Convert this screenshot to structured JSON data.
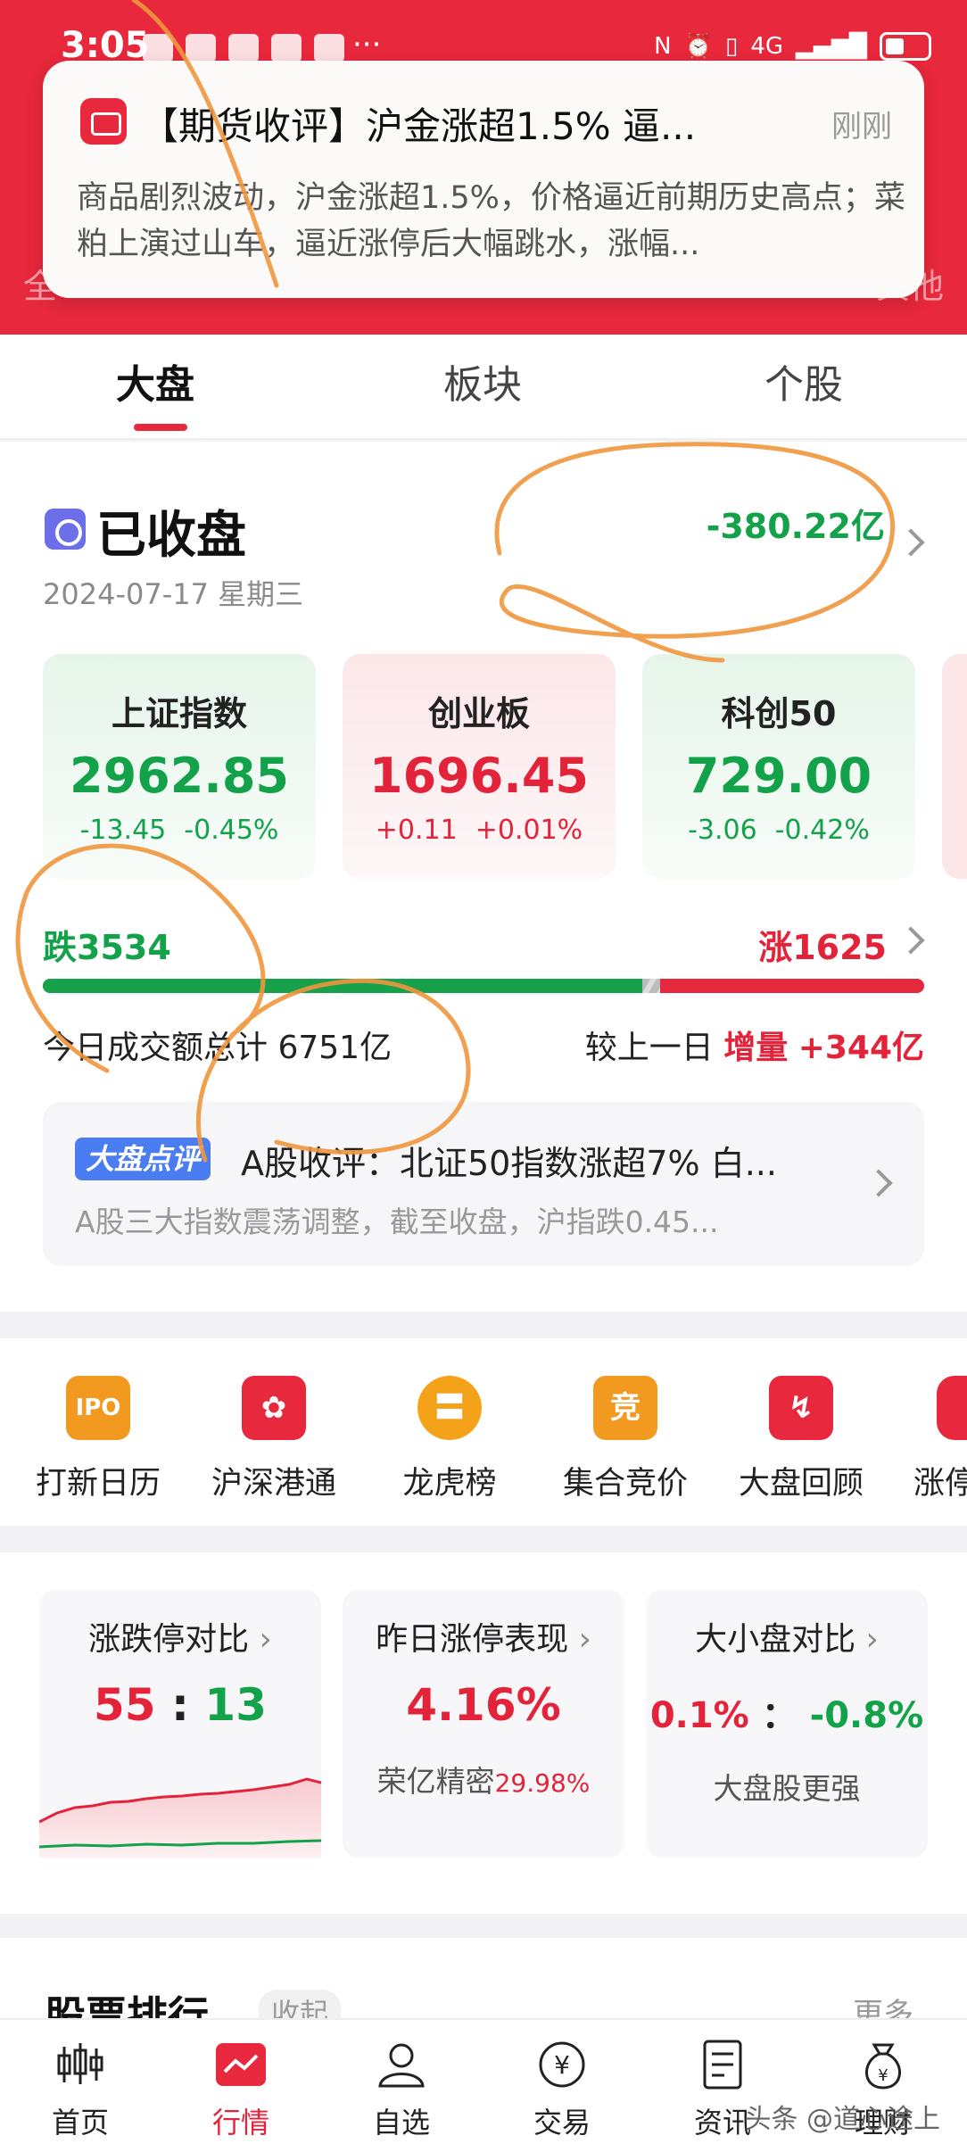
{
  "status_bar": {
    "time": "3:05",
    "dots": "···",
    "network": "4G"
  },
  "header_tabs": [
    "全",
    "其他"
  ],
  "notification": {
    "title": "【期货收评】沪金涨超1.5% 逼...",
    "time": "刚刚",
    "body": "商品剧烈波动，沪金涨超1.5%，价格逼近前期历史高点；菜粕上演过山车，逼近涨停后大幅跳水，涨幅..."
  },
  "main_tabs": [
    "大盘",
    "板块",
    "个股"
  ],
  "market": {
    "status": "已收盘",
    "date": "2024-07-17 星期三",
    "net_flow": "-380.22亿",
    "indices": [
      {
        "name": "上证指数",
        "value": "2962.85",
        "change": "-13.45",
        "pct": "-0.45%"
      },
      {
        "name": "创业板",
        "value": "1696.45",
        "change": "+0.11",
        "pct": "+0.01%"
      },
      {
        "name": "科创50",
        "value": "729.00",
        "change": "-3.06",
        "pct": "-0.42%"
      }
    ],
    "fall": "跌3534",
    "rise": "涨1625",
    "fall_ratio": 0.68,
    "flat_ratio": 0.02,
    "volume_label": "今日成交额总计",
    "volume_value": "6751亿",
    "compare_label": "较上一日",
    "compare_kind": "增量",
    "compare_value": "+344亿",
    "commentary": {
      "badge": "大盘点评",
      "title": "A股收评：北证50指数涨超7% 白...",
      "sub": "A股三大指数震荡调整，截至收盘，沪指跌0.45..."
    }
  },
  "tools": [
    {
      "label": "打新日历",
      "icon": "IPO",
      "color": "#f29a1f"
    },
    {
      "label": "沪深港通",
      "icon": "✿",
      "color": "#e8283c"
    },
    {
      "label": "龙虎榜",
      "icon": "〓",
      "color": "#f4a21a"
    },
    {
      "label": "集合竞价",
      "icon": "竞",
      "color": "#f29a1f"
    },
    {
      "label": "大盘回顾",
      "icon": "↯",
      "color": "#e8283c"
    },
    {
      "label": "涨停",
      "icon": "",
      "color": "#e8283c"
    }
  ],
  "stats": [
    {
      "title": "涨跌停对比",
      "up": "55",
      "sep": ":",
      "down": "13"
    },
    {
      "title": "昨日涨停表现",
      "big": "4.16%",
      "sub_name": "荣亿精密",
      "sub_value": "29.98%"
    },
    {
      "title": "大小盘对比",
      "left": "0.1%",
      "sep": "：",
      "right": "-0.8%",
      "sub": "大盘股更强"
    }
  ],
  "ranking": {
    "title": "股票排行",
    "collapse": "收起",
    "more": "更多"
  },
  "bottom_nav": [
    "首页",
    "行情",
    "自选",
    "交易",
    "资讯",
    "理财"
  ],
  "watermark": "头条 @道心途上",
  "colors": {
    "brand_red": "#e8283c",
    "up_red": "#e2233a",
    "down_green": "#13a24a",
    "info_blue": "#4a7cf2"
  }
}
